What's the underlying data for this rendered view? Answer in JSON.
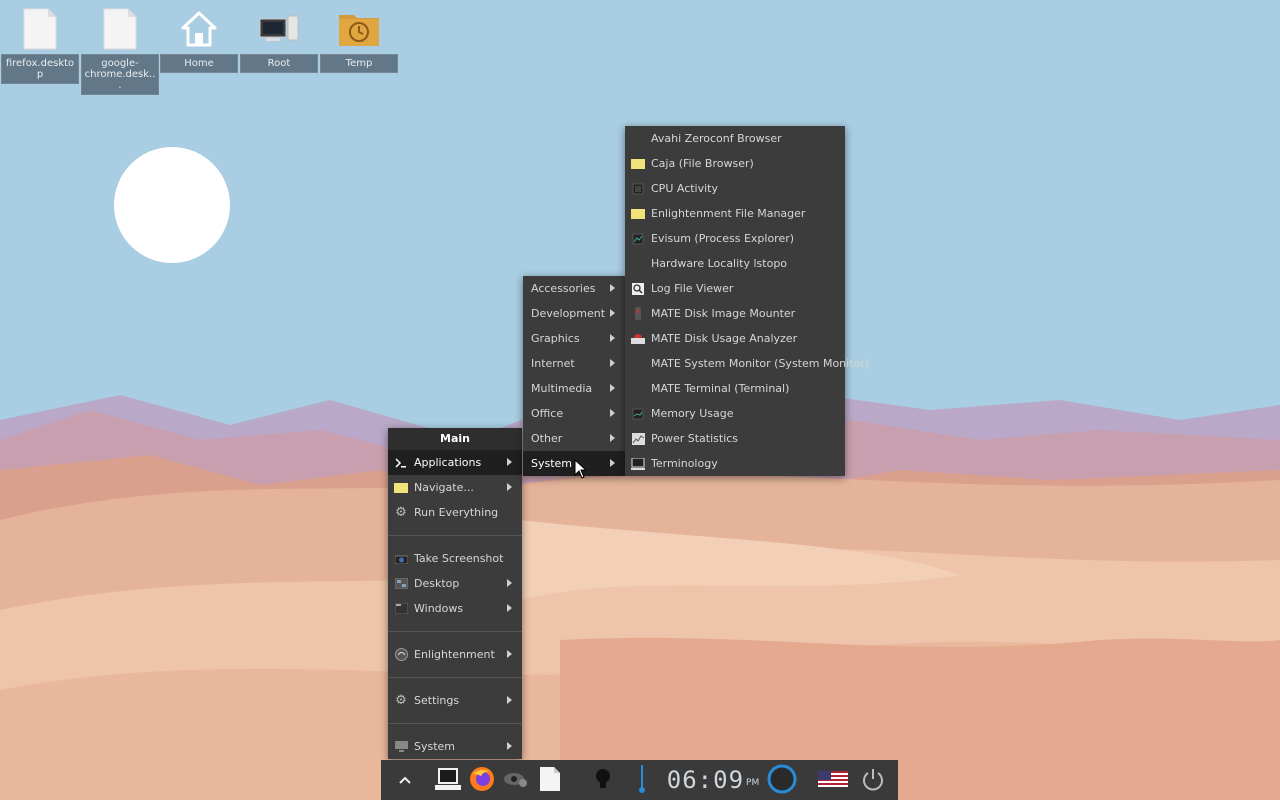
{
  "desktop": {
    "icons": [
      {
        "label": "firefox.desktop"
      },
      {
        "label": "google-chrome.desk..."
      },
      {
        "label": "Home"
      },
      {
        "label": "Root"
      },
      {
        "label": "Temp"
      }
    ]
  },
  "main_menu": {
    "title": "Main",
    "items": [
      {
        "label": "Applications",
        "icon": "terminal-prompt-icon"
      },
      {
        "label": "Navigate...",
        "icon": "folder-icon"
      },
      {
        "label": "Run Everything",
        "icon": "gear-icon"
      },
      {
        "label": "Take Screenshot",
        "icon": "camera-icon"
      },
      {
        "label": "Desktop",
        "icon": "desktop-icon"
      },
      {
        "label": "Windows",
        "icon": "windows-icon"
      },
      {
        "label": "Enlightenment",
        "icon": "enlightenment-icon"
      },
      {
        "label": "Settings",
        "icon": "gear-icon"
      },
      {
        "label": "System",
        "icon": "monitor-icon"
      }
    ]
  },
  "apps_menu": {
    "items": [
      {
        "label": "Accessories"
      },
      {
        "label": "Development"
      },
      {
        "label": "Graphics"
      },
      {
        "label": "Internet"
      },
      {
        "label": "Multimedia"
      },
      {
        "label": "Office"
      },
      {
        "label": "Other"
      },
      {
        "label": "System"
      }
    ]
  },
  "system_menu": {
    "items": [
      {
        "label": "Avahi Zeroconf Browser",
        "icon": ""
      },
      {
        "label": "Caja (File Browser)",
        "icon": "folder-icon"
      },
      {
        "label": "CPU Activity",
        "icon": "cpu-icon"
      },
      {
        "label": "Enlightenment File Manager",
        "icon": "folder-icon"
      },
      {
        "label": "Evisum (Process Explorer)",
        "icon": "process-icon"
      },
      {
        "label": "Hardware Locality lstopo",
        "icon": ""
      },
      {
        "label": "Log File Viewer",
        "icon": "log-viewer-icon"
      },
      {
        "label": "MATE Disk Image Mounter",
        "icon": "disk-mounter-icon"
      },
      {
        "label": "MATE Disk Usage Analyzer",
        "icon": "disk-usage-icon"
      },
      {
        "label": "MATE System Monitor (System Monitor)",
        "icon": ""
      },
      {
        "label": "MATE Terminal (Terminal)",
        "icon": ""
      },
      {
        "label": "Memory Usage",
        "icon": "memory-icon"
      },
      {
        "label": "Power Statistics",
        "icon": "power-stats-icon"
      },
      {
        "label": "Terminology",
        "icon": "terminology-icon"
      }
    ]
  },
  "taskbar": {
    "clock": "06:09",
    "ampm": "PM"
  },
  "colors": {
    "sky": "#a9cde2",
    "menu_bg": "#3c3c3c",
    "menu_selected": "#1f1f1f",
    "taskbar_bg": "#3a3a3a",
    "accent_blue": "#2a8bd6"
  }
}
